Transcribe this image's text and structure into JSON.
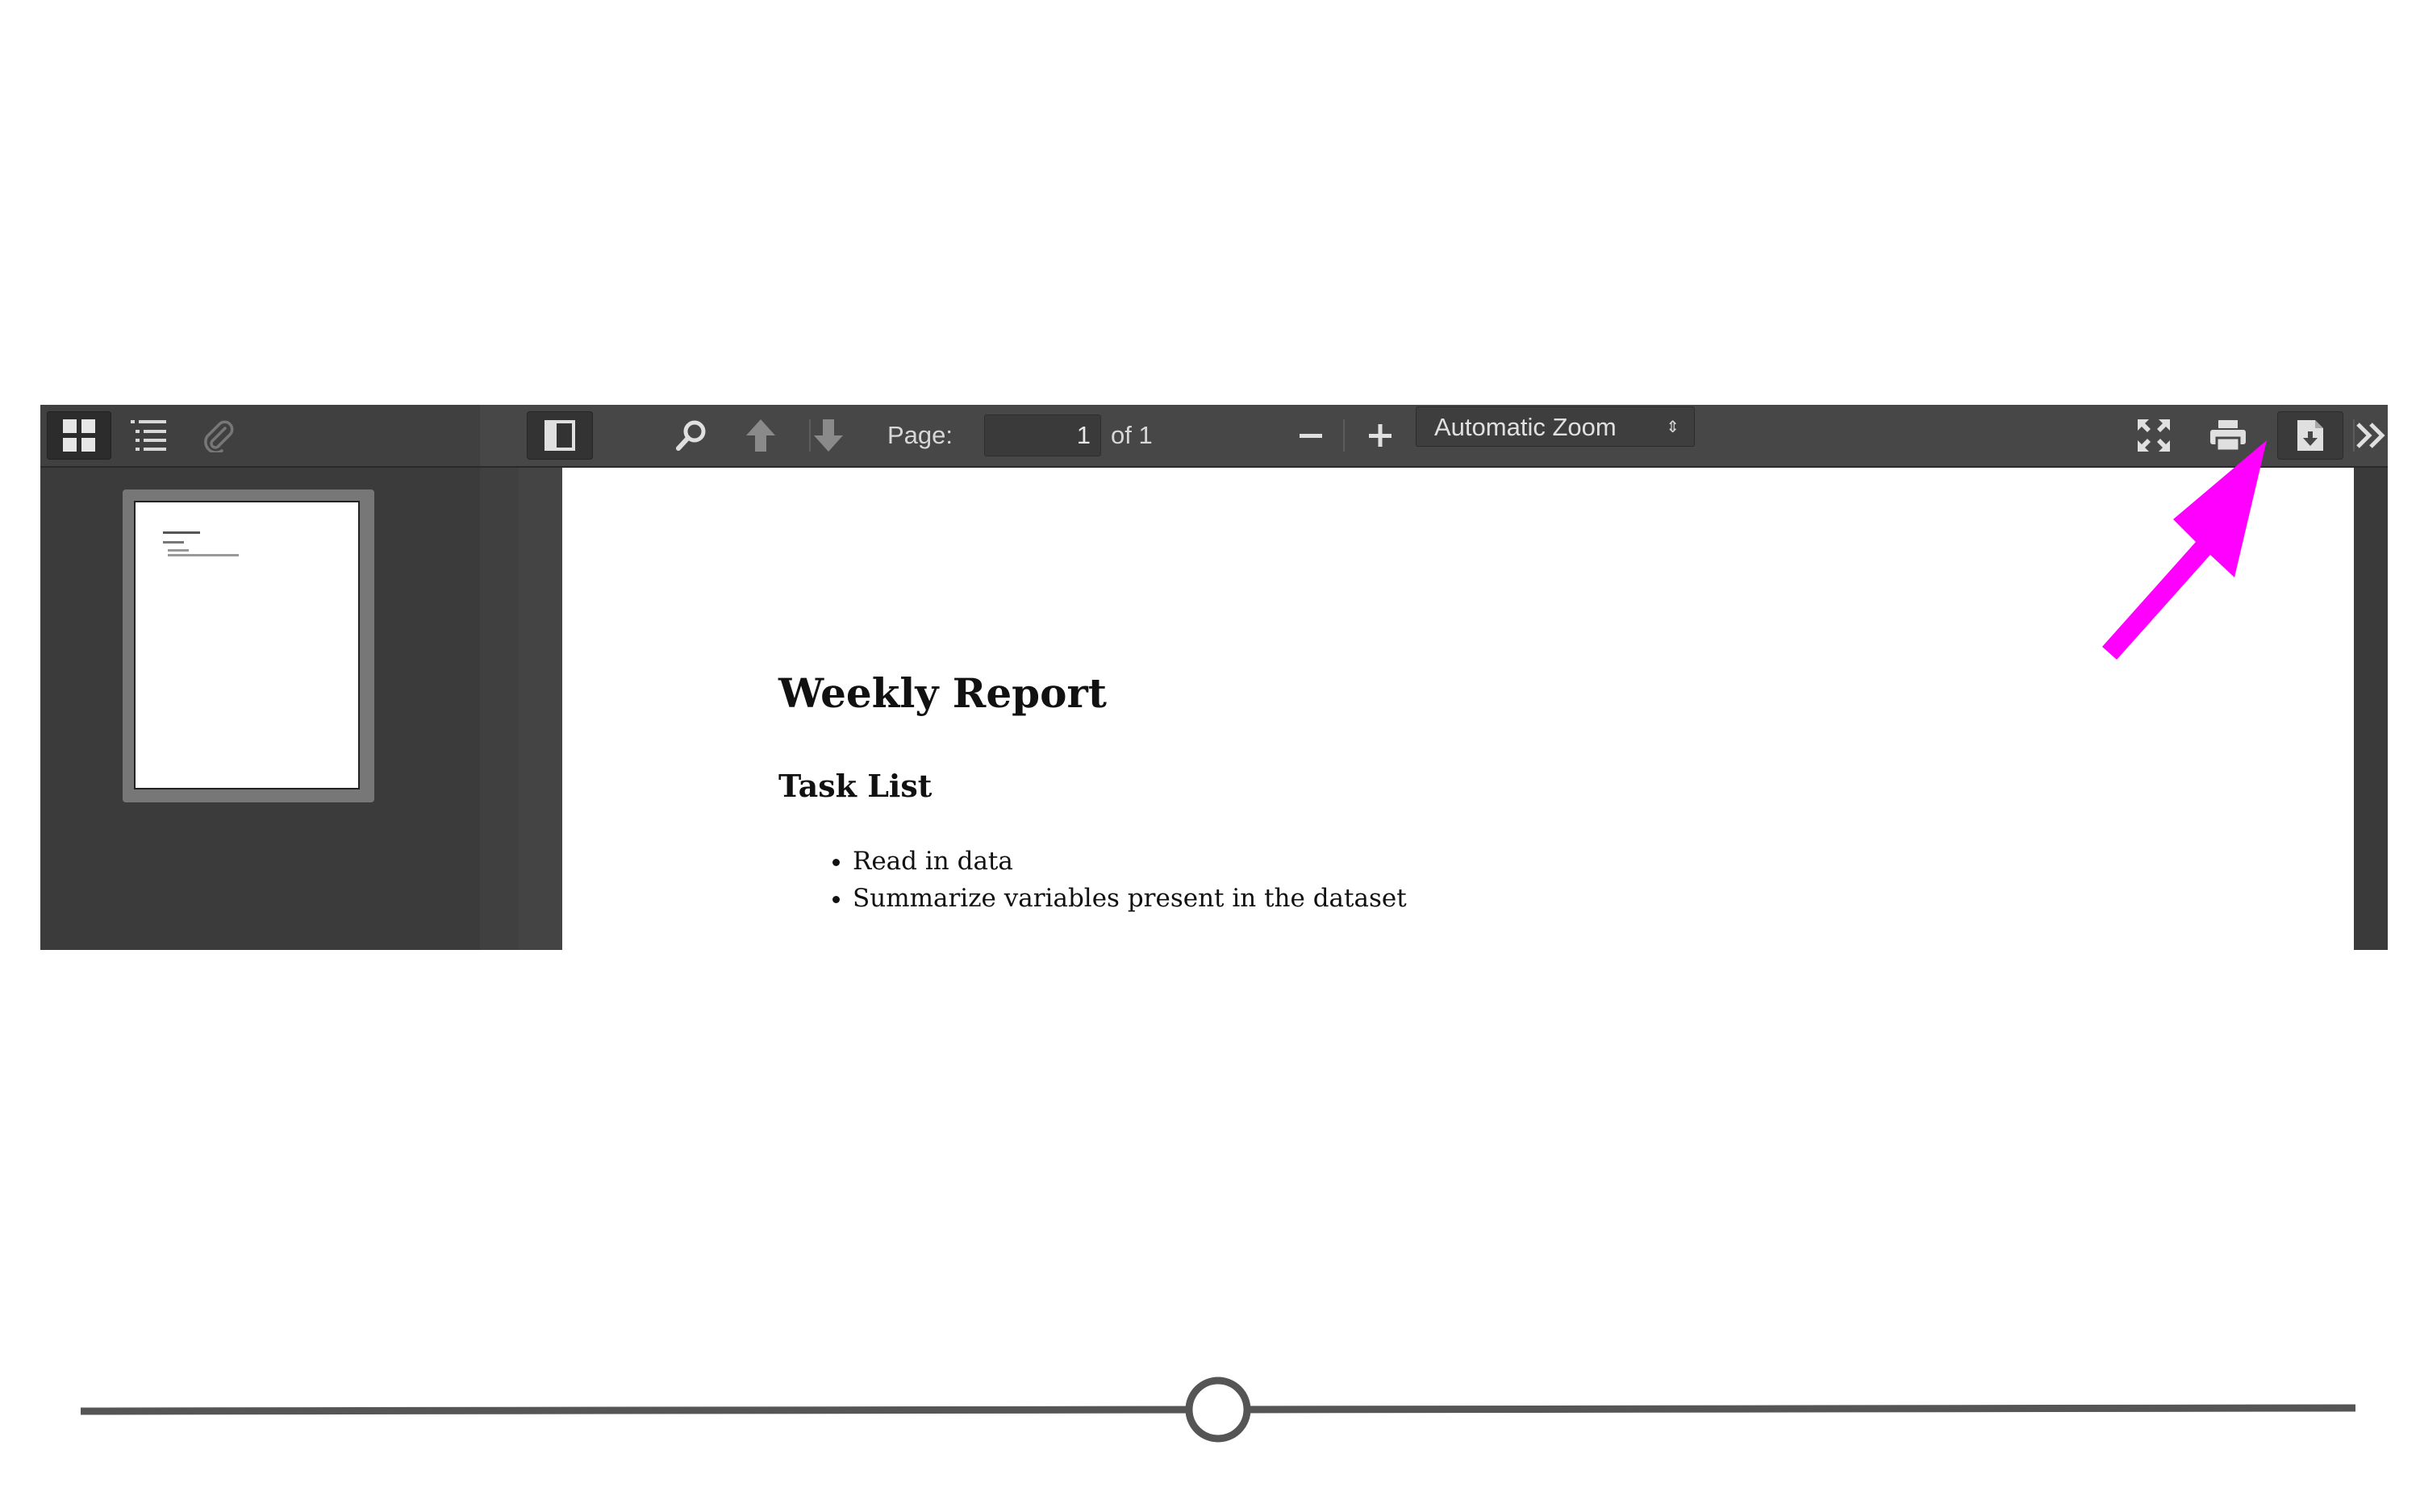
{
  "toolbar": {
    "page_label": "Page:",
    "page_value": "1",
    "page_of": "of 1",
    "zoom_value": "Automatic Zoom",
    "icons": {
      "thumbnail_view": "grid-icon",
      "outline_view": "list-icon",
      "attachments_view": "paperclip-icon",
      "sidebar_toggle": "sidebar-toggle-icon",
      "find": "search-icon",
      "previous_page": "arrow-up-icon",
      "next_page": "arrow-down-icon",
      "zoom_out": "minus-icon",
      "zoom_in": "plus-icon",
      "zoom_dropdown": "updown-icon",
      "presentation_mode": "fullscreen-icon",
      "print": "printer-icon",
      "download": "download-icon",
      "tools": "double-chevron-right-icon"
    }
  },
  "document": {
    "title": "Weekly Report",
    "section_heading": "Task List",
    "tasks": [
      "Read in data",
      "Summarize variables present in the dataset"
    ]
  },
  "annotation": {
    "color": "#ff00ff",
    "target": "download-button"
  },
  "slider": {
    "value": 0.5
  }
}
